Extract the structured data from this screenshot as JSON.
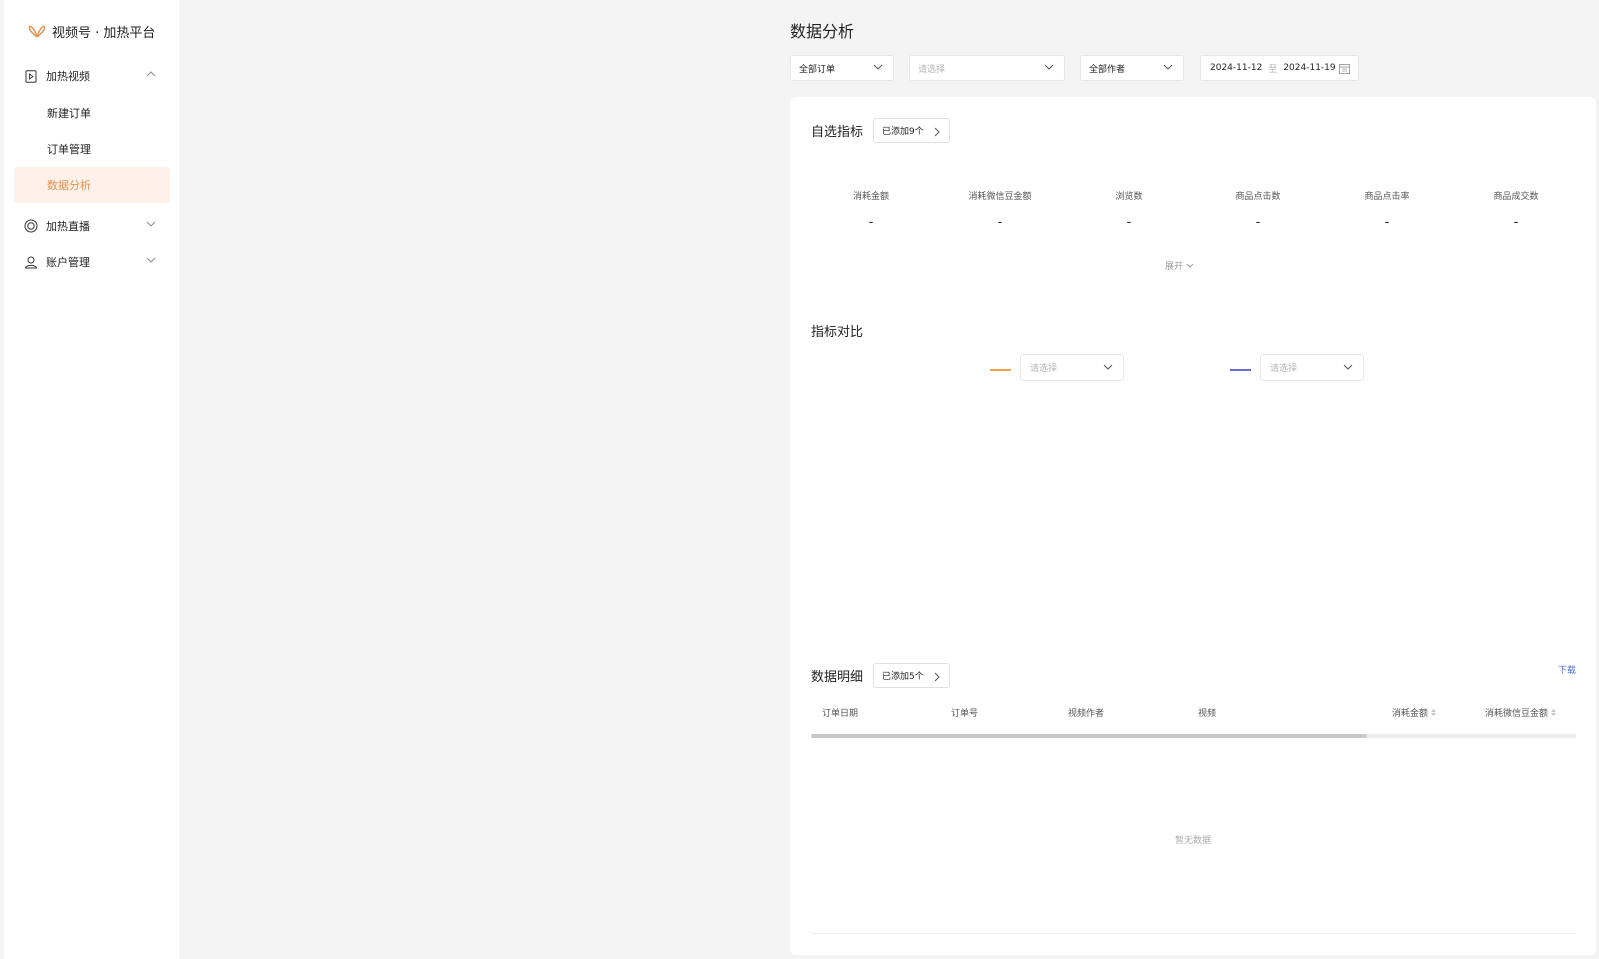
{
  "app": {
    "title": "视频号 · 加热平台",
    "logo_icon": "butterfly-logo-icon",
    "accent": "#e5924e"
  },
  "sidebar": {
    "groups": [
      {
        "label": "加热视频",
        "icon": "video-file-icon",
        "expanded": true
      },
      {
        "label": "加热直播",
        "icon": "live-circle-icon",
        "expanded": false
      },
      {
        "label": "账户管理",
        "icon": "user-account-icon",
        "expanded": false
      }
    ],
    "video_items": [
      {
        "label": "新建订单",
        "active": false
      },
      {
        "label": "订单管理",
        "active": false
      },
      {
        "label": "数据分析",
        "active": true
      }
    ]
  },
  "page": {
    "title": "数据分析"
  },
  "filters": {
    "order_type": "全部订单",
    "order_placeholder": "请选择",
    "author": "全部作者",
    "date_start": "2024-11-12",
    "date_sep": "至",
    "date_end": "2024-11-19"
  },
  "metrics_section": {
    "title": "自选指标",
    "added_label": "已添加9个",
    "metrics": [
      {
        "label": "消耗金额",
        "value": "-"
      },
      {
        "label": "消耗微信豆金额",
        "value": "-"
      },
      {
        "label": "浏览数",
        "value": "-"
      },
      {
        "label": "商品点击数",
        "value": "-"
      },
      {
        "label": "商品点击率",
        "value": "-"
      },
      {
        "label": "商品成交数",
        "value": "-"
      }
    ],
    "expand_label": "展开"
  },
  "compare_section": {
    "title": "指标对比",
    "left": {
      "placeholder": "请选择",
      "color": "#f0a545"
    },
    "right": {
      "placeholder": "请选择",
      "color": "#6a6ad6"
    }
  },
  "detail_section": {
    "title": "数据明细",
    "added_label": "已添加5个",
    "download_label": "下载",
    "columns": [
      {
        "label": "订单日期",
        "sortable": false
      },
      {
        "label": "订单号",
        "sortable": false
      },
      {
        "label": "视频作者",
        "sortable": false
      },
      {
        "label": "视频",
        "sortable": false
      },
      {
        "label": "消耗金额",
        "sortable": true
      },
      {
        "label": "消耗微信豆金额",
        "sortable": true
      }
    ],
    "empty_text": "暂无数据"
  }
}
